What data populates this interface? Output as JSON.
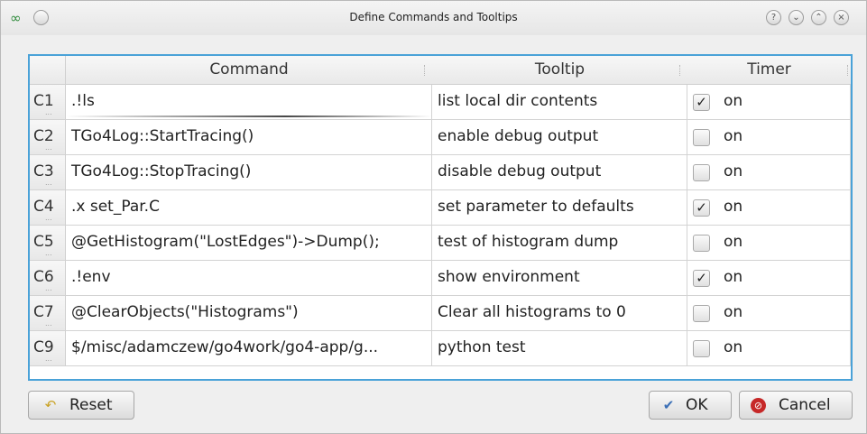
{
  "window": {
    "title": "Define Commands and Tooltips"
  },
  "table": {
    "columns": [
      "Command",
      "Tooltip",
      "Timer"
    ],
    "rows": [
      {
        "id": "C1",
        "command": ".!ls",
        "tooltip": "list local dir contents",
        "timer_checked": true,
        "timer_label": "on"
      },
      {
        "id": "C2",
        "command": "TGo4Log::StartTracing()",
        "tooltip": "enable debug output",
        "timer_checked": false,
        "timer_label": "on"
      },
      {
        "id": "C3",
        "command": "TGo4Log::StopTracing()",
        "tooltip": "disable debug output",
        "timer_checked": false,
        "timer_label": "on"
      },
      {
        "id": "C4",
        "command": ".x set_Par.C",
        "tooltip": "set parameter to defaults",
        "timer_checked": true,
        "timer_label": "on"
      },
      {
        "id": "C5",
        "command": "@GetHistogram(\"LostEdges\")->Dump();",
        "tooltip": "test of histogram dump",
        "timer_checked": false,
        "timer_label": "on"
      },
      {
        "id": "C6",
        "command": ".!env",
        "tooltip": "show environment",
        "timer_checked": true,
        "timer_label": "on"
      },
      {
        "id": "C7",
        "command": "@ClearObjects(\"Histograms\")",
        "tooltip": "Clear all histograms to 0",
        "timer_checked": false,
        "timer_label": "on"
      },
      {
        "id": "C9",
        "command": "$/misc/adamczew/go4work/go4-app/g...",
        "tooltip": "python test",
        "timer_checked": false,
        "timer_label": "on"
      }
    ]
  },
  "buttons": {
    "reset": "Reset",
    "ok": "OK",
    "cancel": "Cancel"
  },
  "colors": {
    "selection_border": "#4aa2d8",
    "cancel_icon": "#c62828",
    "ok_icon": "#3b6fb6"
  }
}
